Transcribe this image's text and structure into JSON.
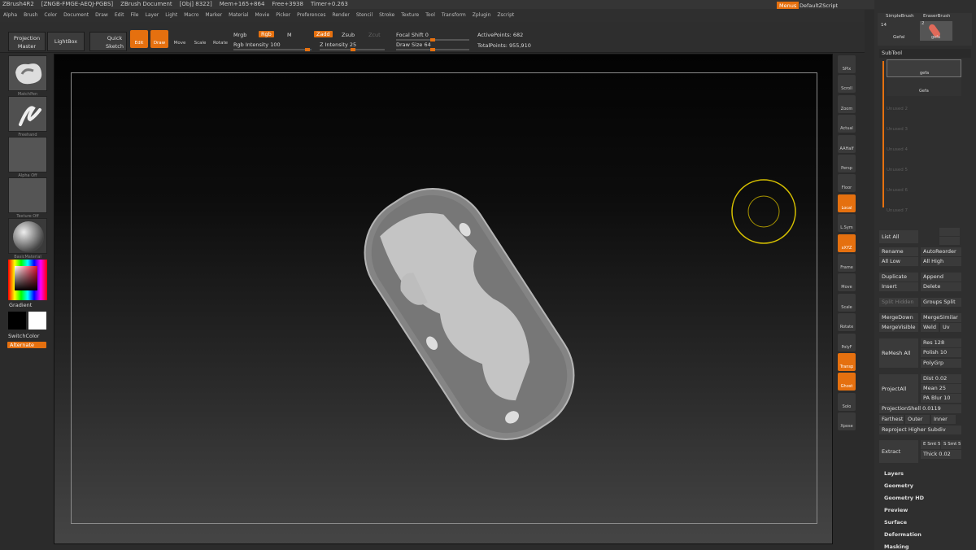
{
  "title_bar": {
    "app": "ZBrush4R2",
    "serial": "[ZNGB-FMGE-AEQJ-PGBS]",
    "doc": "ZBrush Document",
    "obj": "[Obj] 8322]",
    "mem": "Mem+165+864",
    "free": "Free+3938",
    "timer": "Timer+0.263"
  },
  "top_right": {
    "menus": "Menus",
    "script": "DefaultZScript"
  },
  "menu": [
    "Alpha",
    "Brush",
    "Color",
    "Document",
    "Draw",
    "Edit",
    "File",
    "Layer",
    "Light",
    "Macro",
    "Marker",
    "Material",
    "Movie",
    "Picker",
    "Preferences",
    "Render",
    "Stencil",
    "Stroke",
    "Texture",
    "Tool",
    "Transform",
    "Zplugin",
    "Zscript"
  ],
  "shelf": {
    "projection_master": "Projection Master",
    "lightbox": "LightBox",
    "quick_sketch": "Quick Sketch",
    "tools": [
      {
        "label": "Edit",
        "on": true
      },
      {
        "label": "Draw",
        "on": true
      },
      {
        "label": "Move",
        "on": false
      },
      {
        "label": "Scale",
        "on": false
      },
      {
        "label": "Rotate",
        "on": false
      }
    ],
    "mrgb": "Mrgb",
    "rgb": "Rgb",
    "m": "M",
    "zadd": "Zadd",
    "zsub": "Zsub",
    "zcut": "Zcut",
    "rgb_intensity": "Rgb Intensity 100",
    "z_intensity": "Z Intensity 25",
    "focal_shift": "Focal Shift 0",
    "draw_size": "Draw Size 64",
    "active_points": "ActivePoints: 682",
    "total_points": "TotalPoints: 955,910"
  },
  "left": {
    "brush": "MatchPen",
    "stroke": "Freehand",
    "alpha": "Alpha Off",
    "texture": "Texture Off",
    "material": "BasicMaterial",
    "gradient": "Gradient",
    "switch": "SwitchColor",
    "alternate": "Alternate"
  },
  "right_tools": [
    {
      "label": "SPix",
      "on": false
    },
    {
      "label": "Scroll",
      "on": false
    },
    {
      "label": "Zoom",
      "on": false
    },
    {
      "label": "Actual",
      "on": false
    },
    {
      "label": "AAHalf",
      "on": false
    },
    {
      "label": "Persp",
      "on": false
    },
    {
      "label": "Floor",
      "on": false
    },
    {
      "label": "Local",
      "on": true
    },
    {
      "label": "L.Sym",
      "on": false
    },
    {
      "label": "xXYZ",
      "on": true
    },
    {
      "label": "Frame",
      "on": false
    },
    {
      "label": "Move",
      "on": false
    },
    {
      "label": "Scale",
      "on": false
    },
    {
      "label": "Rotate",
      "on": false
    },
    {
      "label": "PolyF",
      "on": false
    },
    {
      "label": "Transp",
      "on": true
    },
    {
      "label": "Ghost",
      "on": true
    },
    {
      "label": "Solo",
      "on": false
    },
    {
      "label": "Xpose",
      "on": false
    }
  ],
  "tool_palette": {
    "count": "14",
    "simple_brush": "SimpleBrush",
    "eraser_brush": "EraserBrush",
    "tool1": "Gefal",
    "tool2_num": "2",
    "tool2": "gefa"
  },
  "subtool": {
    "header": "SubTool",
    "items": [
      "gefa",
      "Gefa"
    ],
    "unused": [
      "Unused 2",
      "Unused 3",
      "Unused 4",
      "Unused 5",
      "Unused 6",
      "Unused 7"
    ],
    "list_all": "List All",
    "rename": "Rename",
    "auto_reorder": "AutoReorder",
    "all_low": "All Low",
    "all_high": "All High",
    "duplicate": "Duplicate",
    "append": "Append",
    "insert": "Insert",
    "delete": "Delete",
    "split_hidden": "Split Hidden",
    "groups_split": "Groups Split",
    "merge_down": "MergeDown",
    "merge_similar": "MergeSimilar",
    "merge_visible": "MergeVisible",
    "weld": "Weld",
    "uv": "Uv",
    "remesh_all": "ReMesh All",
    "res": "Res 128",
    "polish": "Polish 10",
    "polygrp": "PolyGrp",
    "project_all": "ProjectAll",
    "dist": "Dist 0.02",
    "mean": "Mean 25",
    "pa_blur": "PA Blur 10",
    "projection_shell": "ProjectionShell 0.0119",
    "farthest": "Farthest",
    "outer": "Outer",
    "inner": "Inner",
    "reproject": "Reproject Higher Subdiv",
    "extract": "Extract",
    "e_smt": "E Smt 5",
    "s_smt": "S Smt 5",
    "thick": "Thick 0.02"
  },
  "sections": [
    "Layers",
    "Geometry",
    "Geometry HD",
    "Preview",
    "Surface",
    "Deformation",
    "Masking"
  ]
}
